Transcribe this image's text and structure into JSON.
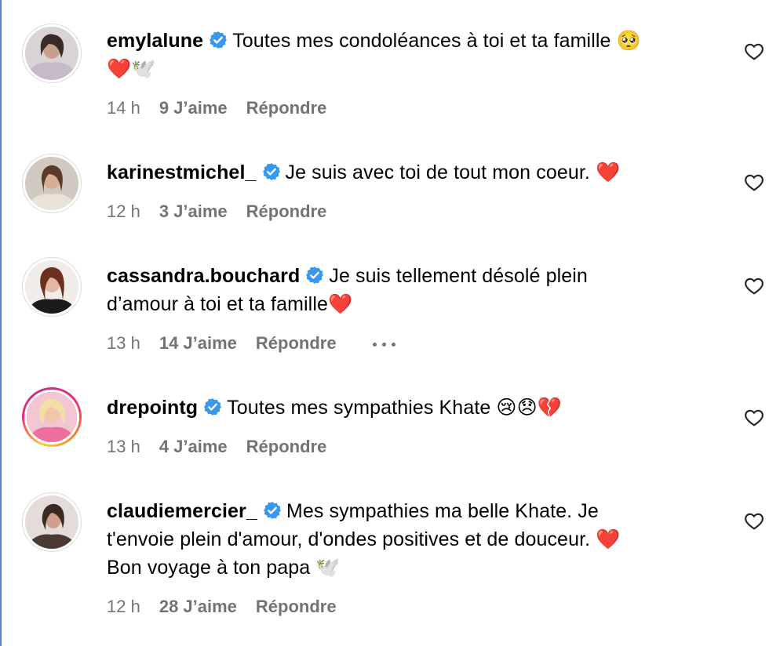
{
  "colors": {
    "verified_badge": "#3897f0",
    "meta_text": "#737373",
    "heart_red": "#e0293e",
    "story_ring": [
      "#f9ce34",
      "#ee2a7b",
      "#c13584"
    ]
  },
  "comments": [
    {
      "username": "emylalune",
      "verified": true,
      "text_line1": "Toutes mes condoléances à toi et ta famille 🥺",
      "text_line2": "❤️🕊️",
      "text_line3": "",
      "time": "14 h",
      "likes": "9 J’aime",
      "reply_label": "Répondre",
      "avatar_icon": "user-photo-avatar"
    },
    {
      "username": "karinestmichel_",
      "verified": true,
      "text_line1": "Je suis avec toi de tout mon coeur. ❤️",
      "text_line2": "",
      "text_line3": "",
      "time": "12 h",
      "likes": "3 J’aime",
      "reply_label": "Répondre",
      "avatar_icon": "user-photo-avatar"
    },
    {
      "username": "cassandra.bouchard",
      "verified": true,
      "text_line1": "Je suis tellement désolé plein",
      "text_line2": "d’amour à toi et ta famille❤️",
      "text_line3": "",
      "time": "13 h",
      "likes": "14 J’aime",
      "reply_label": "Répondre",
      "more_icon": "more-options-icon",
      "avatar_icon": "user-photo-avatar"
    },
    {
      "username": "drepointg",
      "verified": true,
      "has_story": true,
      "text_line1": "Toutes mes sympathies Khate 😢😞💔",
      "text_line2": "",
      "text_line3": "",
      "time": "13 h",
      "likes": "4 J’aime",
      "reply_label": "Répondre",
      "avatar_icon": "user-photo-avatar"
    },
    {
      "username": "claudiemercier_",
      "verified": true,
      "text_line1": "Mes sympathies ma belle Khate. Je",
      "text_line2": "t'envoie plein d'amour, d'ondes positives et de douceur. ❤️",
      "text_line3": "Bon voyage à ton papa 🕊️",
      "time": "12 h",
      "likes": "28 J’aime",
      "reply_label": "Répondre",
      "avatar_icon": "user-photo-avatar"
    }
  ]
}
